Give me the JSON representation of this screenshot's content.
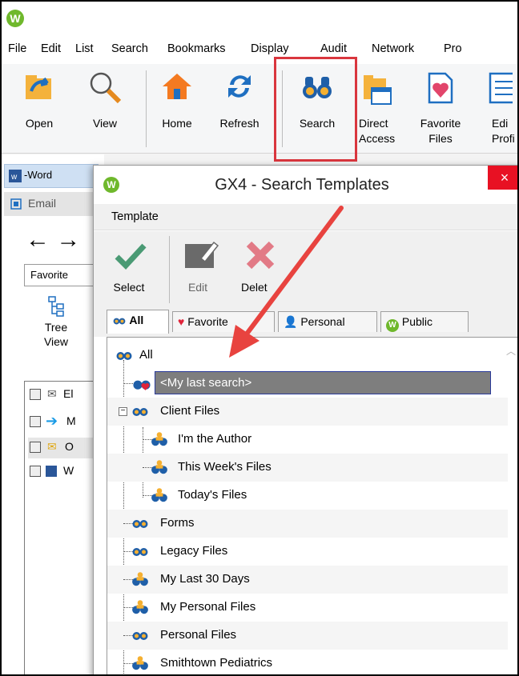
{
  "app": {
    "logo_letter": "W",
    "menu": [
      "File",
      "Edit",
      "List",
      "Search",
      "Bookmarks",
      "Display",
      "Audit",
      "Network",
      "Pro"
    ]
  },
  "ribbon": {
    "open": "Open",
    "view": "View",
    "home": "Home",
    "refresh": "Refresh",
    "search": "Search",
    "direct_access": "Direct\nAccess",
    "favorite_files": "Favorite\nFiles",
    "edit_profile": "Edi\nProfi"
  },
  "background": {
    "doc_tab": "-Word",
    "email_tab": "Email",
    "arrows": "← →",
    "favorite_box": "Favorite",
    "tree_view": "Tree\nView",
    "list_items": [
      "El",
      "M",
      "O",
      "W"
    ]
  },
  "dialog": {
    "title": "GX4 - Search Templates",
    "close": "×",
    "menu": "Template",
    "tools": {
      "select": "Select",
      "edit": "Edit",
      "delete": "Delet"
    },
    "tabs": {
      "all": "All",
      "favorites": "Favorite",
      "personal": "Personal",
      "public": "Public"
    },
    "tree": {
      "root": "All",
      "selected": "<My last search>",
      "client_files": "Client Files",
      "client_children": [
        "I'm the Author",
        "This Week's Files",
        "Today's Files"
      ],
      "items": [
        "Forms",
        "Legacy Files",
        "My Last 30 Days",
        "My Personal Files",
        "Personal Files",
        "Smithtown Pediatrics"
      ]
    }
  },
  "colors": {
    "accent_red": "#d9363e",
    "selection": "#7e7e7e",
    "brand_green": "#6fb82c"
  }
}
